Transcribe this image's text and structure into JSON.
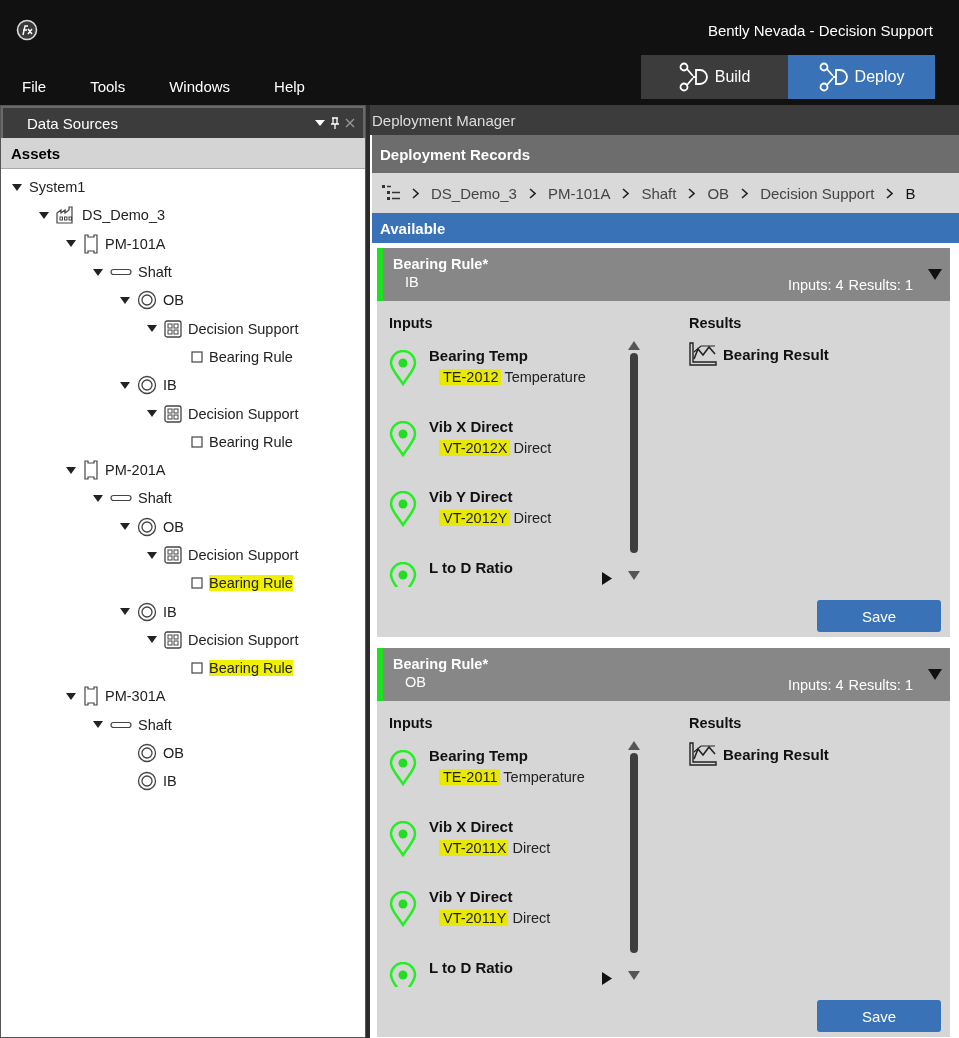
{
  "window": {
    "title": "Bently Nevada - Decision Support"
  },
  "menu": [
    "File",
    "Tools",
    "Windows",
    "Help"
  ],
  "mode_tabs": [
    {
      "label": "Build",
      "selected": false
    },
    {
      "label": "Deploy",
      "selected": true
    }
  ],
  "data_sources": {
    "title": "Data Sources",
    "section": "Assets",
    "tree": [
      {
        "label": "System1",
        "highlighted": false,
        "children": [
          {
            "label": "DS_Demo_3",
            "kind": "plant",
            "highlighted": false,
            "children": [
              {
                "label": "PM-101A",
                "kind": "machine",
                "highlighted": false,
                "children": [
                  {
                    "label": "Shaft",
                    "kind": "shaft",
                    "highlighted": false,
                    "children": [
                      {
                        "label": "OB",
                        "kind": "bearing",
                        "highlighted": false,
                        "children": [
                          {
                            "label": "Decision Support",
                            "kind": "group",
                            "highlighted": false,
                            "children": [
                              {
                                "label": "Bearing Rule",
                                "kind": "rule",
                                "highlighted": false
                              }
                            ]
                          }
                        ]
                      },
                      {
                        "label": "IB",
                        "kind": "bearing",
                        "highlighted": false,
                        "children": [
                          {
                            "label": "Decision Support",
                            "kind": "group",
                            "highlighted": false,
                            "children": [
                              {
                                "label": "Bearing Rule",
                                "kind": "rule",
                                "highlighted": false
                              }
                            ]
                          }
                        ]
                      }
                    ]
                  }
                ]
              },
              {
                "label": "PM-201A",
                "kind": "machine",
                "highlighted": false,
                "children": [
                  {
                    "label": "Shaft",
                    "kind": "shaft",
                    "highlighted": false,
                    "children": [
                      {
                        "label": "OB",
                        "kind": "bearing",
                        "highlighted": false,
                        "children": [
                          {
                            "label": "Decision Support",
                            "kind": "group",
                            "highlighted": false,
                            "children": [
                              {
                                "label": "Bearing Rule",
                                "kind": "rule",
                                "highlighted": true
                              }
                            ]
                          }
                        ]
                      },
                      {
                        "label": "IB",
                        "kind": "bearing",
                        "highlighted": false,
                        "children": [
                          {
                            "label": "Decision Support",
                            "kind": "group",
                            "highlighted": false,
                            "children": [
                              {
                                "label": "Bearing Rule",
                                "kind": "rule",
                                "highlighted": true
                              }
                            ]
                          }
                        ]
                      }
                    ]
                  }
                ]
              },
              {
                "label": "PM-301A",
                "kind": "machine",
                "highlighted": false,
                "children": [
                  {
                    "label": "Shaft",
                    "kind": "shaft",
                    "highlighted": false,
                    "children": [
                      {
                        "label": "OB",
                        "kind": "bearing",
                        "highlighted": false
                      },
                      {
                        "label": "IB",
                        "kind": "bearing",
                        "highlighted": false
                      }
                    ]
                  }
                ]
              }
            ]
          }
        ]
      }
    ]
  },
  "deployment": {
    "title": "Deployment Manager",
    "records_title": "Deployment Records",
    "breadcrumb": [
      "DS_Demo_3",
      "PM-101A",
      "Shaft",
      "OB",
      "Decision Support",
      "B"
    ],
    "section": "Available",
    "cards": [
      {
        "title": "Bearing Rule*",
        "subtitle": "IB",
        "inputs_count": "Inputs: 4",
        "results_count": "Results: 1",
        "inputs_heading": "Inputs",
        "results_heading": "Results",
        "inputs": [
          {
            "name": "Bearing Temp",
            "tag": "TE-2012",
            "type": "Temperature"
          },
          {
            "name": "Vib X Direct",
            "tag": "VT-2012X",
            "type": "Direct"
          },
          {
            "name": "Vib Y Direct",
            "tag": "VT-2012Y",
            "type": "Direct"
          },
          {
            "name": "L to D Ratio"
          }
        ],
        "results": [
          "Bearing Result"
        ],
        "button": "Save"
      },
      {
        "title": "Bearing Rule*",
        "subtitle": "OB",
        "inputs_count": "Inputs: 4",
        "results_count": "Results: 1",
        "inputs_heading": "Inputs",
        "results_heading": "Results",
        "inputs": [
          {
            "name": "Bearing Temp",
            "tag": "TE-2011",
            "type": "Temperature"
          },
          {
            "name": "Vib X Direct",
            "tag": "VT-2011X",
            "type": "Direct"
          },
          {
            "name": "Vib Y Direct",
            "tag": "VT-2011Y",
            "type": "Direct"
          },
          {
            "name": "L to D Ratio"
          }
        ],
        "results": [
          "Bearing Result"
        ],
        "button": "Save"
      }
    ]
  }
}
